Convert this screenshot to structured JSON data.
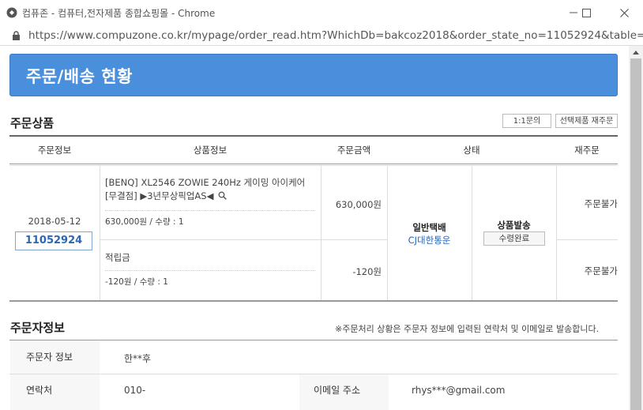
{
  "window": {
    "title": "컴퓨존 - 컴퓨터,전자제품 종합쇼핑몰 - Chrome",
    "url": "https://www.compuzone.co.kr/mypage/order_read.htm?WhichDb=bakcoz2018&order_state_no=11052924&table=Or..."
  },
  "banner": {
    "title": "주문/배송 현황"
  },
  "order_products": {
    "section_title": "주문상품",
    "buttons": {
      "inquiry": "1:1문의",
      "reorder_selected": "선택제품 재주문"
    },
    "headers": {
      "order_info": "주문정보",
      "product_info": "상품정보",
      "amount": "주문금액",
      "status": "상태",
      "reorder": "재주문"
    },
    "order": {
      "date": "2018-05-12",
      "number": "11052924",
      "delivery_type": "일반택배",
      "courier": "CJ대한통운",
      "status": "상품발송",
      "received_button": "수령완료"
    },
    "items": [
      {
        "name_line1": "[BENQ] XL2546 ZOWIE 240Hz 게이밍 아이케어",
        "name_line2": "[무결점] ▶3년무상픽업AS◀",
        "price_qty": "630,000원 / 수량 : 1",
        "amount": "630,000원",
        "reorder": "주문불가"
      },
      {
        "name_line1": "적립금",
        "price_qty": "-120원 / 수량 : 1",
        "amount": "-120원",
        "reorder": "주문불가"
      }
    ]
  },
  "orderer_info": {
    "section_title": "주문자정보",
    "notice": "※주문처리 상황은 주문자 정보에 입력된 연락처 및 이메일로 발송합니다.",
    "rows": {
      "orderer_label": "주문자 정보",
      "orderer_value": "한**후",
      "contact_label": "연락처",
      "contact_value": "010-",
      "email_label": "이메일 주소",
      "email_value": "rhys***@gmail.com"
    }
  }
}
